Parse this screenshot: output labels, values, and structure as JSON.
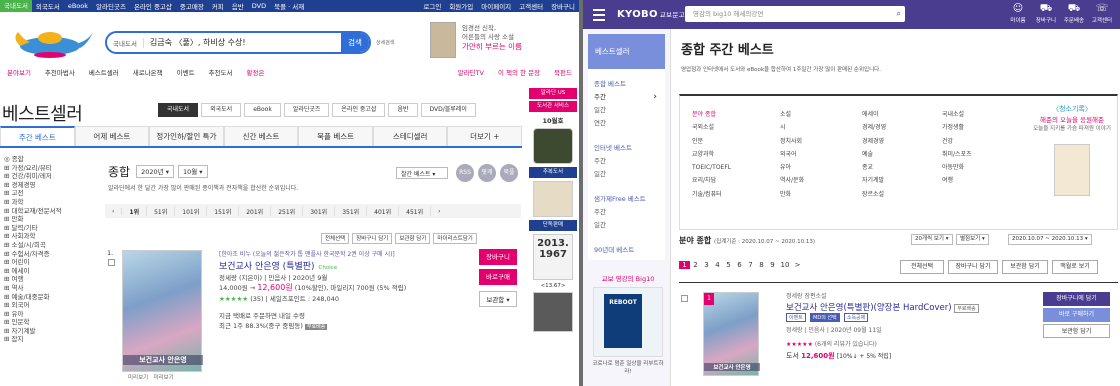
{
  "left": {
    "topnav": {
      "items": [
        "국내도서",
        "외국도서",
        "eBook",
        "알라딘굿즈",
        "온라인 중고샵",
        "중고매장",
        "커피",
        "음반",
        "DVD",
        "북플 · 서재"
      ],
      "right": [
        "로그인",
        "회원가입",
        "마이페이지",
        "고객센터",
        "장바구니"
      ]
    },
    "logo": "알라딘",
    "search": {
      "scope": "국내도서",
      "query": "김금숙 〈풀〉, 하비상 수상!",
      "button": "검색",
      "detail": "상세검색"
    },
    "banner": {
      "line1": "임경선 신작,",
      "line2": "어른들의 사랑 소설",
      "line3": "가만히 부르는 이름"
    },
    "catbar": [
      "분야보기",
      "추천마법사",
      "베스트셀러",
      "새로나온책",
      "이벤트",
      "추천도서",
      "황정은"
    ],
    "catbar_right": [
      "알라딘TV",
      "이 책의 한 문장",
      "북펀드"
    ],
    "page_title": "베스트셀러",
    "rtabs": [
      "국내도서",
      "외국도서",
      "eBook",
      "알라딘굿즈",
      "온라인 중고샵",
      "음반",
      "DVD/블루레이"
    ],
    "main_tabs": [
      "주간 베스트",
      "어제 베스트",
      "정가인하/할인 특가",
      "신간 베스트",
      "북플 베스트",
      "스테디셀러",
      "더보기 +"
    ],
    "sidebar": [
      "종합",
      "가정/요리/뷰티",
      "건강/취미/레저",
      "경제경영",
      "고전",
      "과학",
      "대학교재/전문서적",
      "만화",
      "달력/기타",
      "사회과학",
      "소설/시/희곡",
      "수험서/자격증",
      "어린이",
      "에세이",
      "여행",
      "역사",
      "예술/대중문화",
      "외국어",
      "유아",
      "인문학",
      "자기계발",
      "잡지"
    ],
    "filter": {
      "label": "종합",
      "year": "2020년",
      "month": "10월",
      "sort": "찰간 베스트"
    },
    "circles": [
      "RSS",
      "팟캐",
      "북플"
    ],
    "desc": "알라딘에서 한 달간 가장 많이 판매된 종이책과 전자책을 합산한 순위입니다.",
    "rankbar": [
      "1위",
      "51위",
      "101위",
      "151위",
      "201위",
      "251위",
      "301위",
      "351위",
      "401위",
      "451위"
    ],
    "actions": [
      "전체선택",
      "장바구니 담기",
      "보관함 담기",
      "마이리스트담기"
    ],
    "item": {
      "rank": "1.",
      "promo": "[한아조 비누 (오늘의 젊은작가 톱 맨플사 한국문학 2권 이상 구매 시)]",
      "title": "보건교사 안은영 (특별판)",
      "choice": "Choice",
      "author": "정세랑 (지은이) | 민음사 | 2020년 9월",
      "price_orig": "14,000원 →",
      "price": "12,600원",
      "price_rest": "(10%할인), 마일리지 700원 (5% 적립)",
      "rating": "★★★★★",
      "rating_rest": "(35) | 세일즈포인트 : 248,040",
      "ship": "지금 택배로 주문하면 내일 수령",
      "recent": "최근 1주 88.3%(중구 중림동)",
      "tag": "무료배송",
      "cover_title": "보건교사 안은영",
      "cart": "장바구니",
      "buy": "바로구매",
      "store": "보관함",
      "preview": [
        "미리보기",
        "미리보기"
      ]
    },
    "rail": {
      "pk1": "알라딘 US",
      "pk2": "도서관 서비스",
      "h1": "10월호",
      "h2": "추복도서",
      "h3": "단독판매",
      "number": "2013.1967",
      "price": "<13.67>"
    }
  },
  "right": {
    "logo": "KYOBO",
    "logo_sub": "교보문고",
    "search_placeholder": "영감의 big10 헤세의강연",
    "icons": [
      "마이룸",
      "장바구니",
      "주문배송",
      "고객센터"
    ],
    "nav": {
      "header": "베스트셀러",
      "groups": [
        {
          "title": "종합 베스트",
          "items": [
            "주간",
            "일간",
            "연간"
          ]
        },
        {
          "title": "인터넷 베스트",
          "items": [
            "주간",
            "일간"
          ]
        },
        {
          "title": "샘가제Free 베스트",
          "items": [
            "주간",
            "일간"
          ]
        },
        {
          "title": "90년대 베스트",
          "items": []
        }
      ],
      "bigten": "교보 영강의 Big10",
      "ad_book": "REBOOT",
      "ad_caption": "코로나로 멈춘 일상을 리부트하라!"
    },
    "title": "종합 주간 베스트",
    "desc": "영업점과 인터넷에서 도서와 eBook을 합산하여 1주일간 가장 많이 판매된 순위입니다.",
    "categories": [
      [
        "분야 종합",
        "국외소설",
        "인문",
        "교양과학",
        "TOEIC/TOEFL",
        "요리/차담",
        "기술/컴퓨터"
      ],
      [
        "소설",
        "시",
        "정치사회",
        "외국어",
        "유아",
        "역사/문화",
        "만화"
      ],
      [
        "에세이",
        "경제/경영",
        "경제경영",
        "예술",
        "종교",
        "자기계발",
        "장르소설"
      ],
      [
        "국내소설",
        "가정생활",
        "건강",
        "취미/스포츠",
        "아동만화",
        "여행"
      ]
    ],
    "ad": {
      "h1": "〈청소기록〉",
      "h2": "해준의 오늘을 응원해준",
      "h3": "오늘을 지키를 가슴 따져원 이야기"
    },
    "field": "분야 종합",
    "range": "(집계기준 : 2020.10.07 ~ 2020.10.13)",
    "dropdowns": [
      "20개씩 보기",
      "별점보기",
      "2020.10.07 ~ 2020.10.13"
    ],
    "pages": [
      "1",
      "2",
      "3",
      "4",
      "5",
      "6",
      "7",
      "8",
      "9",
      "10",
      ">"
    ],
    "buttons": [
      "전체선택",
      "장바구니 담기",
      "보관함 담기",
      "맥월로 보기"
    ],
    "item": {
      "rank": "1",
      "meta": "정세랑 장편소설",
      "title": "보건교사 안은영(특별판)(양장본 HardCover)",
      "badge": "무료배송",
      "badges": [
        "이벤트",
        "MD의 선택",
        "소득공제"
      ],
      "author": "정세랑 | 민음사 | 2020년 09월 11일",
      "rating": "★★★★★",
      "rating_rest": "(6개의 리뷰가 있습니다)",
      "price_label": "도서",
      "price": "12,600원",
      "price_rest": "[10%↓ + 5% 적립]",
      "cover_title": "보건교사 안은영",
      "cart": "장바구니에 담기",
      "buy": "바로 구매하기",
      "store": "보관함 담기"
    }
  },
  "colors": {
    "aladin_blue": "#1f3f91",
    "aladin_green": "#4ab34b",
    "pink": "#e3006e",
    "kyobo_purple": "#4a3d8f"
  }
}
